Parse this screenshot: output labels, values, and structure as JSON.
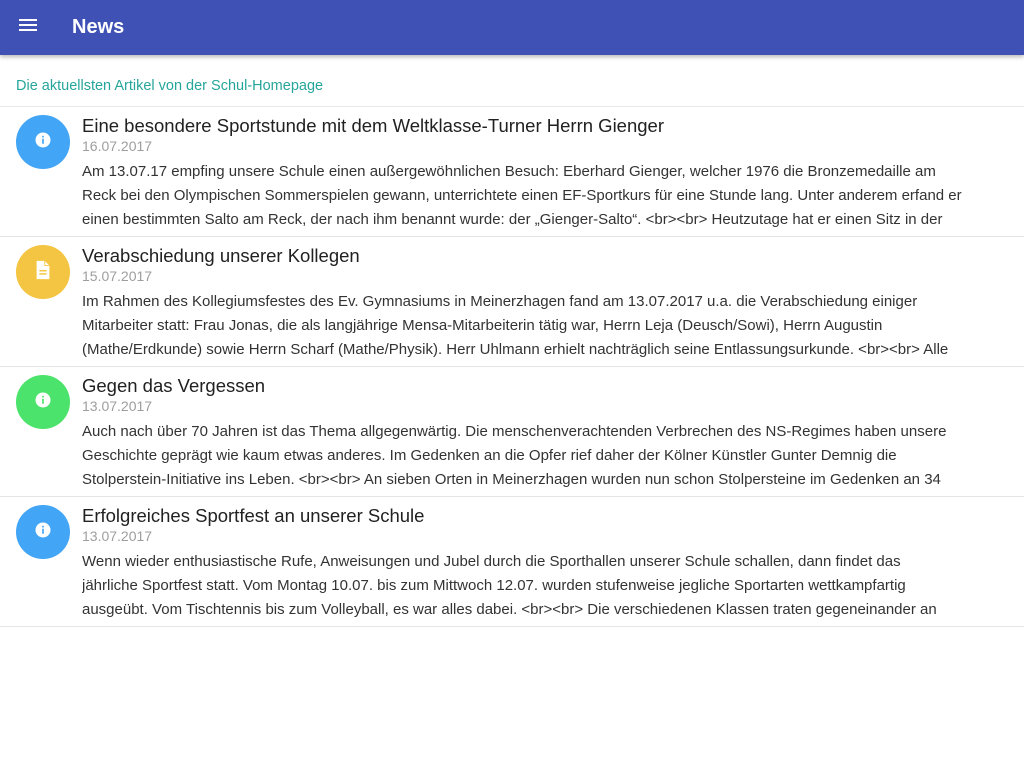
{
  "toolbar": {
    "title": "News",
    "menu_icon": "menu-icon",
    "color": "#3f51b5"
  },
  "subheader": "Die aktuellsten Artikel von der Schul-Homepage",
  "articles": [
    {
      "title": "Eine besondere Sportstunde mit dem Weltklasse-Turner Herrn Gienger",
      "date": "16.07.2017",
      "icon": "info-icon",
      "avatar_color": "#42a5f5",
      "lines": [
        "Am 13.07.17 empfing unsere Schule einen außergewöhnlichen Besuch: Eberhard Gienger, welcher 1976 die Bronzemedaille am",
        "Reck bei den Olympischen Sommerspielen gewann, unterrichtete einen EF-Sportkurs für eine Stunde lang. Unter anderem erfand er",
        "einen bestimmten Salto am Reck, der nach ihm benannt wurde: der „Gienger-Salto“. <br><br> Heutzutage hat er einen Sitz in der"
      ]
    },
    {
      "title": "Verabschiedung unserer Kollegen",
      "date": "15.07.2017",
      "icon": "document-icon",
      "avatar_color": "#f4c542",
      "lines": [
        "Im Rahmen des Kollegiumsfestes des Ev. Gymnasiums in Meinerzhagen fand am 13.07.2017 u.a. die Verabschiedung einiger",
        "Mitarbeiter statt: Frau Jonas, die als langjährige Mensa-Mitarbeiterin tätig war, Herrn Leja (Deusch/Sowi), Herrn Augustin",
        "(Mathe/Erdkunde) sowie Herrn Scharf (Mathe/Physik). Herr Uhlmann erhielt nachträglich seine Entlassungsurkunde. <br><br> Alle"
      ]
    },
    {
      "title": "Gegen das Vergessen",
      "date": "13.07.2017",
      "icon": "info-icon",
      "avatar_color": "#4be36b",
      "lines": [
        "Auch nach über 70 Jahren ist das Thema allgegenwärtig. Die menschenverachtenden Verbrechen des NS-Regimes haben unsere",
        "Geschichte geprägt wie kaum etwas anderes. Im Gedenken an die Opfer rief daher der Kölner Künstler Gunter Demnig die",
        "Stolperstein-Initiative ins Leben. <br><br> An sieben Orten in Meinerzhagen wurden nun schon Stolpersteine im Gedenken an 34"
      ]
    },
    {
      "title": "Erfolgreiches Sportfest an unserer Schule",
      "date": "13.07.2017",
      "icon": "info-icon",
      "avatar_color": "#42a5f5",
      "lines": [
        "Wenn wieder enthusiastische Rufe, Anweisungen und Jubel durch die Sporthallen unserer Schule schallen, dann findet das",
        "jährliche Sportfest statt. Vom Montag 10.07. bis zum Mittwoch 12.07. wurden stufenweise jegliche Sportarten wettkampfartig",
        "ausgeübt. Vom Tischtennis bis zum Volleyball, es war alles dabei. <br><br> Die verschiedenen Klassen traten gegeneinander an"
      ]
    }
  ]
}
